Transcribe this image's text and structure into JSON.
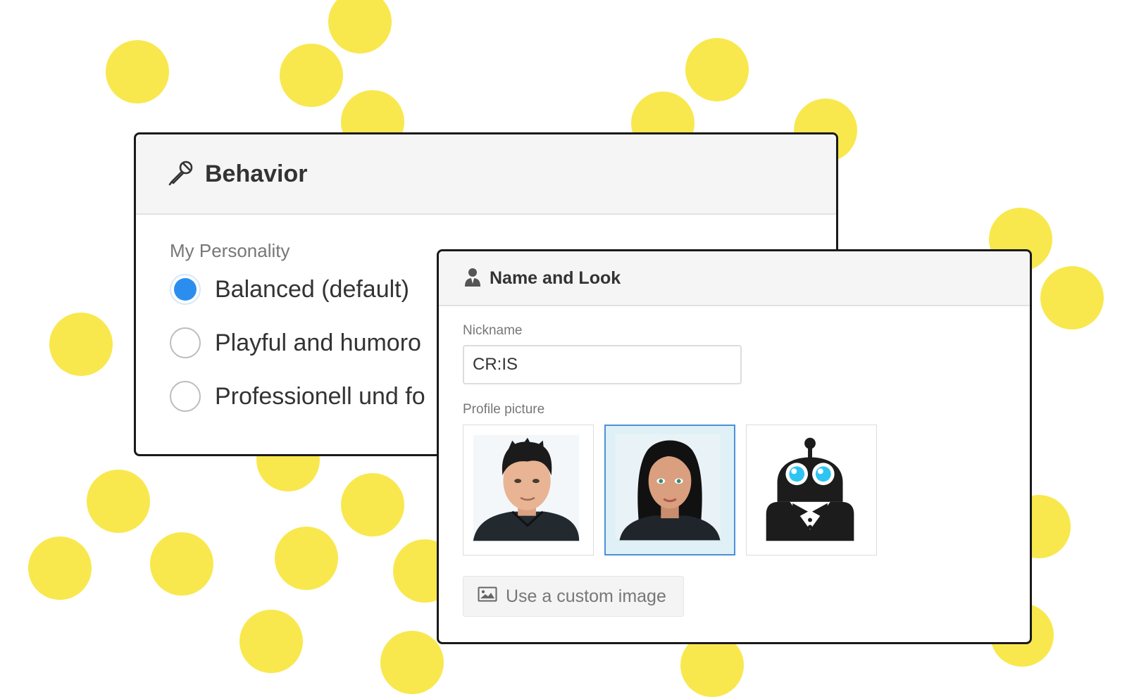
{
  "colors": {
    "dot": "#f8e84e",
    "radio_selected": "#2b8eef",
    "selected_border": "#4a90d9"
  },
  "behavior": {
    "icon": "microphone-icon",
    "title": "Behavior",
    "section_label": "My Personality",
    "options": [
      {
        "label": "Balanced (default)",
        "checked": true
      },
      {
        "label": "Playful and humoro",
        "checked": false
      },
      {
        "label": "Professionell und fo",
        "checked": false
      }
    ]
  },
  "name_and_look": {
    "icon": "person-icon",
    "title": "Name and Look",
    "nickname_label": "Nickname",
    "nickname_value": "CR:IS",
    "profile_label": "Profile picture",
    "pictures": [
      {
        "name": "male-avatar",
        "selected": false
      },
      {
        "name": "female-avatar",
        "selected": true
      },
      {
        "name": "robot-avatar",
        "selected": false
      }
    ],
    "custom_image_icon": "image-icon",
    "custom_image_label": "Use a custom image"
  }
}
